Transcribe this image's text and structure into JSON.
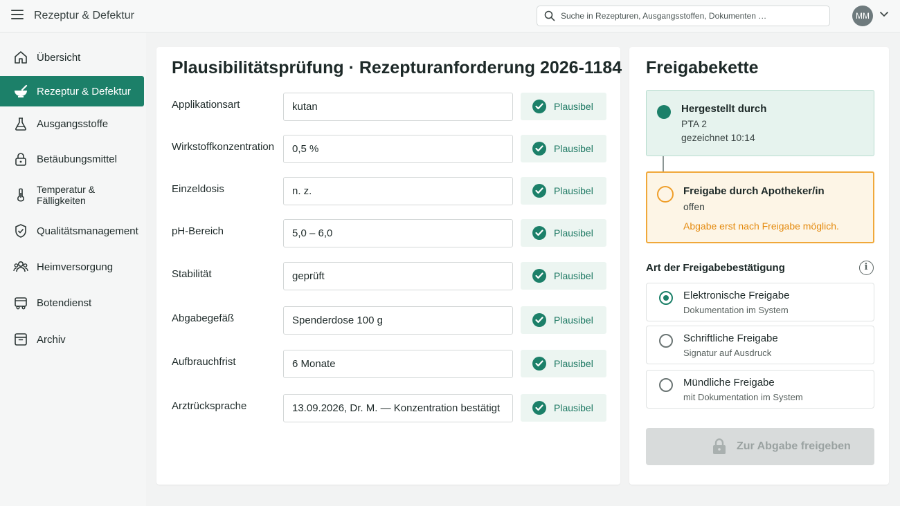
{
  "header": {
    "app_title": "Rezeptur & Defektur",
    "search_placeholder": "Suche in Rezepturen, Ausgangsstoffen, Dokumenten …",
    "avatar_initials": "MM"
  },
  "sidebar": {
    "items": [
      {
        "label": "Übersicht",
        "icon": "home-icon"
      },
      {
        "label": "Rezeptur & Defektur",
        "icon": "mortar-icon",
        "active": true
      },
      {
        "label": "Ausgangsstoffe",
        "icon": "flask-icon"
      },
      {
        "label": "Betäubungsmittel",
        "icon": "lock-icon"
      },
      {
        "label": "Temperatur & Fälligkeiten",
        "icon": "thermometer-icon"
      },
      {
        "label": "Qualitätsmanagement",
        "icon": "shield-check-icon"
      },
      {
        "label": "Heimversorgung",
        "icon": "people-icon"
      },
      {
        "label": "Botendienst",
        "icon": "delivery-icon"
      },
      {
        "label": "Archiv",
        "icon": "archive-icon"
      }
    ]
  },
  "main": {
    "title": "Plausibilitätsprüfung · Rezepturanforderung 2026-1184",
    "rows": [
      {
        "label": "Applikationsart",
        "value": "kutan",
        "status": "Plausibel"
      },
      {
        "label": "Wirkstoffkonzentration",
        "value": "0,5 %",
        "status": "Plausibel"
      },
      {
        "label": "Einzeldosis",
        "value": "n. z.",
        "status": "Plausibel"
      },
      {
        "label": "pH-Bereich",
        "value": "5,0 – 6,0",
        "status": "Plausibel"
      },
      {
        "label": "Stabilität",
        "value": "geprüft",
        "status": "Plausibel"
      },
      {
        "label": "Abgabegefäß",
        "value": "Spenderdose 100 g",
        "status": "Plausibel"
      },
      {
        "label": "Aufbrauchfrist",
        "value": "6 Monate",
        "status": "Plausibel"
      },
      {
        "label": "Arztrücksprache",
        "value": "13.09.2026, Dr. M. — Konzentration bestätigt",
        "status": "Plausibel"
      }
    ]
  },
  "chain": {
    "title": "Freigabekette",
    "step1": {
      "title": "Hergestellt durch",
      "line1": "PTA 2",
      "line2": "gezeichnet 10:14"
    },
    "step2": {
      "title": "Freigabe durch Apotheker/in",
      "line1": "offen",
      "warning": "Abgabe erst nach Freigabe möglich."
    },
    "confirm_label": "Art der Freigabebestätigung",
    "options": [
      {
        "title": "Elektronische Freigabe",
        "sub": "Dokumentation im System",
        "selected": true
      },
      {
        "title": "Schriftliche Freigabe",
        "sub": "Signatur auf Ausdruck",
        "selected": false
      },
      {
        "title": "Mündliche Freigabe",
        "sub": "mit Dokumentation im System",
        "selected": false
      }
    ],
    "release_button": "Zur Abgabe freigeben"
  },
  "colors": {
    "accent": "#1c8069",
    "warning": "#f0a83a",
    "plausible_bg": "#ecf5f1"
  }
}
